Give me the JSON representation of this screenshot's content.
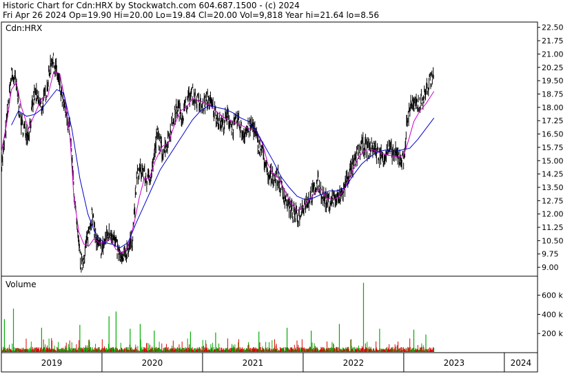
{
  "header": {
    "line1": "Historic Chart for Cdn:HRX by Stockwatch.com 604.687.1500 - (c) 2024",
    "line2": "Fri Apr 26 2024   Op=19.90   Hi=20.00   Lo=19.84   Cl=20.00   Vol=9,818   Year hi=21.64   lo=8.56"
  },
  "chart_data": [
    {
      "type": "line",
      "title": "",
      "label": "Cdn:HRX",
      "y_ticks": [
        "22.50",
        "21.75",
        "21.00",
        "20.25",
        "19.50",
        "18.75",
        "18.00",
        "17.25",
        "16.50",
        "15.75",
        "15.00",
        "14.25",
        "13.50",
        "12.75",
        "12.00",
        "11.25",
        "10.50",
        "9.75",
        "9.00"
      ],
      "ylim": [
        8.5,
        22.8
      ],
      "grid": false,
      "series": [
        {
          "name": "",
          "color": "#000000",
          "points": [
            [
              2019.0,
              14.5
            ],
            [
              2019.05,
              17.0
            ],
            [
              2019.1,
              19.8
            ],
            [
              2019.14,
              19.5
            ],
            [
              2019.2,
              17.0
            ],
            [
              2019.27,
              16.5
            ],
            [
              2019.33,
              18.8
            ],
            [
              2019.4,
              18.0
            ],
            [
              2019.45,
              19.0
            ],
            [
              2019.5,
              20.8
            ],
            [
              2019.55,
              20.0
            ],
            [
              2019.62,
              18.0
            ],
            [
              2019.68,
              16.8
            ],
            [
              2019.72,
              13.5
            ],
            [
              2019.76,
              10.5
            ],
            [
              2019.8,
              9.0
            ],
            [
              2019.85,
              10.5
            ],
            [
              2019.9,
              12.0
            ],
            [
              2019.95,
              10.3
            ],
            [
              2020.0,
              10.0
            ],
            [
              2020.05,
              10.8
            ],
            [
              2020.1,
              11.0
            ],
            [
              2020.15,
              10.0
            ],
            [
              2020.2,
              9.3
            ],
            [
              2020.25,
              10.0
            ],
            [
              2020.3,
              10.5
            ],
            [
              2020.35,
              14.2
            ],
            [
              2020.4,
              14.5
            ],
            [
              2020.45,
              13.8
            ],
            [
              2020.5,
              14.5
            ],
            [
              2020.55,
              16.5
            ],
            [
              2020.6,
              15.5
            ],
            [
              2020.65,
              16.0
            ],
            [
              2020.7,
              17.2
            ],
            [
              2020.75,
              18.0
            ],
            [
              2020.8,
              17.5
            ],
            [
              2020.85,
              18.4
            ],
            [
              2020.9,
              18.8
            ],
            [
              2020.95,
              18.3
            ],
            [
              2021.0,
              18.0
            ],
            [
              2021.05,
              18.5
            ],
            [
              2021.1,
              18.0
            ],
            [
              2021.15,
              17.4
            ],
            [
              2021.2,
              17.0
            ],
            [
              2021.25,
              17.5
            ],
            [
              2021.3,
              16.8
            ],
            [
              2021.35,
              17.3
            ],
            [
              2021.4,
              16.5
            ],
            [
              2021.45,
              16.8
            ],
            [
              2021.5,
              17.0
            ],
            [
              2021.55,
              16.0
            ],
            [
              2021.6,
              15.5
            ],
            [
              2021.65,
              14.0
            ],
            [
              2021.7,
              14.2
            ],
            [
              2021.75,
              14.0
            ],
            [
              2021.8,
              13.2
            ],
            [
              2021.85,
              12.6
            ],
            [
              2021.9,
              12.0
            ],
            [
              2021.95,
              11.8
            ],
            [
              2022.0,
              12.5
            ],
            [
              2022.05,
              12.8
            ],
            [
              2022.1,
              13.2
            ],
            [
              2022.15,
              13.8
            ],
            [
              2022.2,
              12.9
            ],
            [
              2022.25,
              12.6
            ],
            [
              2022.3,
              12.9
            ],
            [
              2022.35,
              12.8
            ],
            [
              2022.4,
              13.3
            ],
            [
              2022.45,
              14.2
            ],
            [
              2022.5,
              14.7
            ],
            [
              2022.55,
              15.5
            ],
            [
              2022.6,
              15.9
            ],
            [
              2022.65,
              15.6
            ],
            [
              2022.7,
              15.8
            ],
            [
              2022.75,
              15.3
            ],
            [
              2022.8,
              15.2
            ],
            [
              2022.85,
              15.6
            ],
            [
              2022.9,
              15.4
            ],
            [
              2022.95,
              15.2
            ],
            [
              2023.0,
              15.0
            ],
            [
              2023.03,
              17.0
            ],
            [
              2023.07,
              18.3
            ],
            [
              2023.11,
              18.0
            ],
            [
              2023.15,
              18.2
            ],
            [
              2023.2,
              18.6
            ],
            [
              2023.25,
              19.3
            ],
            [
              2023.3,
              20.0
            ]
          ]
        },
        {
          "name": "",
          "color": "#cc00cc",
          "points": [
            [
              2019.0,
              15.5
            ],
            [
              2019.05,
              17.0
            ],
            [
              2019.1,
              19.0
            ],
            [
              2019.15,
              19.4
            ],
            [
              2019.2,
              18.0
            ],
            [
              2019.27,
              16.8
            ],
            [
              2019.33,
              17.6
            ],
            [
              2019.4,
              18.5
            ],
            [
              2019.46,
              18.6
            ],
            [
              2019.52,
              20.0
            ],
            [
              2019.58,
              19.9
            ],
            [
              2019.63,
              18.5
            ],
            [
              2019.68,
              16.5
            ],
            [
              2019.72,
              13.0
            ],
            [
              2019.77,
              11.0
            ],
            [
              2019.82,
              10.3
            ],
            [
              2019.87,
              10.2
            ],
            [
              2019.92,
              10.6
            ],
            [
              2019.97,
              10.4
            ],
            [
              2020.02,
              10.4
            ],
            [
              2020.08,
              10.6
            ],
            [
              2020.14,
              10.0
            ],
            [
              2020.2,
              9.8
            ],
            [
              2020.26,
              10.2
            ],
            [
              2020.32,
              11.5
            ],
            [
              2020.37,
              12.9
            ],
            [
              2020.42,
              14.0
            ],
            [
              2020.47,
              14.0
            ],
            [
              2020.53,
              15.0
            ],
            [
              2020.6,
              15.8
            ],
            [
              2020.66,
              16.0
            ],
            [
              2020.72,
              17.0
            ],
            [
              2020.78,
              17.8
            ],
            [
              2020.84,
              18.0
            ],
            [
              2020.9,
              18.5
            ],
            [
              2020.95,
              18.4
            ],
            [
              2021.0,
              18.3
            ],
            [
              2021.08,
              18.1
            ],
            [
              2021.15,
              17.7
            ],
            [
              2021.22,
              17.4
            ],
            [
              2021.3,
              17.2
            ],
            [
              2021.38,
              17.0
            ],
            [
              2021.46,
              16.8
            ],
            [
              2021.53,
              16.7
            ],
            [
              2021.6,
              15.9
            ],
            [
              2021.65,
              14.8
            ],
            [
              2021.7,
              14.3
            ],
            [
              2021.76,
              14.0
            ],
            [
              2021.82,
              13.3
            ],
            [
              2021.88,
              12.6
            ],
            [
              2021.94,
              12.2
            ],
            [
              2022.0,
              12.4
            ],
            [
              2022.06,
              12.8
            ],
            [
              2022.12,
              13.2
            ],
            [
              2022.18,
              13.4
            ],
            [
              2022.23,
              12.9
            ],
            [
              2022.3,
              12.8
            ],
            [
              2022.36,
              13.0
            ],
            [
              2022.42,
              13.5
            ],
            [
              2022.48,
              14.3
            ],
            [
              2022.55,
              15.2
            ],
            [
              2022.62,
              15.6
            ],
            [
              2022.7,
              15.6
            ],
            [
              2022.78,
              15.4
            ],
            [
              2022.86,
              15.3
            ],
            [
              2022.94,
              15.2
            ],
            [
              2023.0,
              15.3
            ],
            [
              2023.05,
              16.2
            ],
            [
              2023.1,
              17.2
            ],
            [
              2023.16,
              17.8
            ],
            [
              2023.22,
              18.2
            ],
            [
              2023.3,
              18.9
            ]
          ]
        },
        {
          "name": "",
          "color": "#0000cc",
          "points": [
            [
              2019.1,
              17.0
            ],
            [
              2019.17,
              17.8
            ],
            [
              2019.25,
              17.5
            ],
            [
              2019.33,
              17.6
            ],
            [
              2019.4,
              17.9
            ],
            [
              2019.48,
              18.5
            ],
            [
              2019.55,
              19.0
            ],
            [
              2019.62,
              18.8
            ],
            [
              2019.7,
              16.8
            ],
            [
              2019.78,
              14.0
            ],
            [
              2019.86,
              12.0
            ],
            [
              2019.94,
              10.8
            ],
            [
              2020.02,
              10.4
            ],
            [
              2020.1,
              10.3
            ],
            [
              2020.18,
              10.1
            ],
            [
              2020.26,
              10.4
            ],
            [
              2020.34,
              11.5
            ],
            [
              2020.42,
              12.5
            ],
            [
              2020.5,
              13.5
            ],
            [
              2020.58,
              14.5
            ],
            [
              2020.66,
              15.2
            ],
            [
              2020.74,
              15.9
            ],
            [
              2020.82,
              16.6
            ],
            [
              2020.9,
              17.3
            ],
            [
              2020.98,
              17.8
            ],
            [
              2021.06,
              18.1
            ],
            [
              2021.14,
              18.0
            ],
            [
              2021.22,
              17.9
            ],
            [
              2021.3,
              17.7
            ],
            [
              2021.38,
              17.4
            ],
            [
              2021.46,
              17.2
            ],
            [
              2021.54,
              16.6
            ],
            [
              2021.62,
              15.8
            ],
            [
              2021.7,
              15.0
            ],
            [
              2021.78,
              14.1
            ],
            [
              2021.86,
              13.5
            ],
            [
              2021.94,
              13.0
            ],
            [
              2022.02,
              12.8
            ],
            [
              2022.1,
              12.9
            ],
            [
              2022.18,
              13.1
            ],
            [
              2022.26,
              13.3
            ],
            [
              2022.34,
              13.3
            ],
            [
              2022.42,
              13.5
            ],
            [
              2022.5,
              14.2
            ],
            [
              2022.58,
              14.8
            ],
            [
              2022.66,
              15.2
            ],
            [
              2022.74,
              15.5
            ],
            [
              2022.82,
              15.6
            ],
            [
              2022.9,
              15.5
            ],
            [
              2022.98,
              15.6
            ],
            [
              2023.06,
              15.7
            ],
            [
              2023.14,
              16.2
            ],
            [
              2023.22,
              16.8
            ],
            [
              2023.3,
              17.4
            ]
          ]
        }
      ]
    },
    {
      "type": "bar",
      "title": "",
      "label": "Volume",
      "y_ticks": [
        "600 k",
        "400 k",
        "200 k"
      ],
      "ylim": [
        0,
        770
      ],
      "spikes": [
        [
          2019.03,
          350
        ],
        [
          2019.12,
          460
        ],
        [
          2019.4,
          260
        ],
        [
          2019.78,
          290
        ],
        [
          2020.07,
          380
        ],
        [
          2020.14,
          430
        ],
        [
          2020.28,
          250
        ],
        [
          2020.38,
          300
        ],
        [
          2020.52,
          230
        ],
        [
          2020.88,
          220
        ],
        [
          2021.13,
          210
        ],
        [
          2021.56,
          220
        ],
        [
          2021.84,
          260
        ],
        [
          2022.08,
          230
        ],
        [
          2022.36,
          300
        ],
        [
          2022.6,
          730
        ],
        [
          2022.76,
          250
        ],
        [
          2023.1,
          240
        ],
        [
          2023.22,
          190
        ]
      ]
    }
  ],
  "x_axis": {
    "labels": [
      "2019",
      "2020",
      "2021",
      "2022",
      "2023",
      "2024"
    ]
  }
}
